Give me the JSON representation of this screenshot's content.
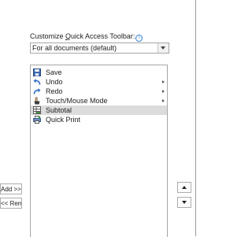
{
  "qat_section": {
    "label_pre": "Customize ",
    "label_accel": "Q",
    "label_post": "uick Access Toolbar:",
    "info_glyph": "i",
    "scope_value": "For all documents (default)"
  },
  "commands": [
    {
      "label": "Save",
      "icon": "save-icon",
      "has_submenu": false,
      "selected": false
    },
    {
      "label": "Undo",
      "icon": "undo-icon",
      "has_submenu": true,
      "selected": false
    },
    {
      "label": "Redo",
      "icon": "redo-icon",
      "has_submenu": true,
      "selected": false
    },
    {
      "label": "Touch/Mouse Mode",
      "icon": "touch-mouse-icon",
      "has_submenu": true,
      "selected": false
    },
    {
      "label": "Subtotal",
      "icon": "subtotal-icon",
      "has_submenu": false,
      "selected": true
    },
    {
      "label": "Quick Print",
      "icon": "quick-print-icon",
      "has_submenu": false,
      "selected": false
    }
  ],
  "buttons": {
    "add_label": "Add >>",
    "remove_label": "<< Remove"
  },
  "colors": {
    "accent": "#2b7cd3",
    "selection": "#dcdcdc",
    "border": "#a6a6a6"
  }
}
